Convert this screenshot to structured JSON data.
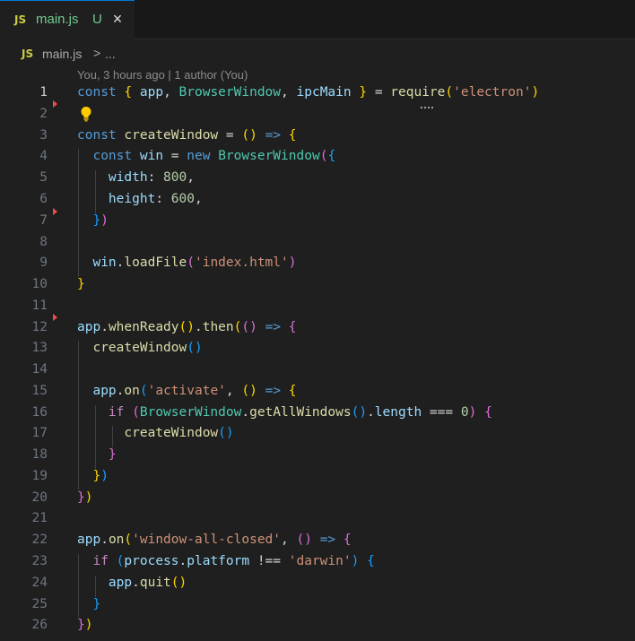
{
  "tab": {
    "badge": "JS",
    "filename": "main.js",
    "status": "U",
    "close_icon": "×"
  },
  "breadcrumb": {
    "badge": "JS",
    "file": "main.js",
    "separator": ">",
    "more": "..."
  },
  "blame": "You, 3 hours ago | 1 author (You)",
  "line_numbers": [
    "1",
    "2",
    "3",
    "4",
    "5",
    "6",
    "7",
    "8",
    "9",
    "10",
    "11",
    "12",
    "13",
    "14",
    "15",
    "16",
    "17",
    "18",
    "19",
    "20",
    "21",
    "22",
    "23",
    "24",
    "25",
    "26"
  ],
  "colors": {
    "accent": "#0078d4",
    "modified_marker": "#f14c4c",
    "lightbulb": "#ffcc00"
  },
  "code": {
    "l1": {
      "const": "const",
      "lb": "{",
      "app": "app",
      "c1": ",",
      "bw": "BrowserWindow",
      "c2": ",",
      "ipc": "ipcMain",
      "rb": "}",
      "eq": "=",
      "req": "require",
      "lp": "(",
      "str": "'electron'",
      "rp": ")"
    },
    "l3": {
      "const": "const",
      "name": "createWindow",
      "eq": "=",
      "parens": "()",
      "arrow": "=>",
      "lb": "{"
    },
    "l4": {
      "const": "const",
      "win": "win",
      "eq": "=",
      "new": "new",
      "cls": "BrowserWindow",
      "lp": "(",
      "lb": "{"
    },
    "l5": {
      "key": "width",
      "colon": ":",
      "num": "800",
      "comma": ","
    },
    "l6": {
      "key": "height",
      "colon": ":",
      "num": "600",
      "comma": ","
    },
    "l7": {
      "rb": "}",
      "rp": ")"
    },
    "l9": {
      "obj": "win",
      "dot": ".",
      "fn": "loadFile",
      "lp": "(",
      "str": "'index.html'",
      "rp": ")"
    },
    "l10": {
      "rb": "}"
    },
    "l12": {
      "obj": "app",
      "dot1": ".",
      "fn1": "whenReady",
      "p1": "()",
      "dot2": ".",
      "fn2": "then",
      "lp": "(",
      "p2": "()",
      "arrow": "=>",
      "lb": "{"
    },
    "l13": {
      "fn": "createWindow",
      "p": "()"
    },
    "l15": {
      "obj": "app",
      "dot": ".",
      "fn": "on",
      "lp": "(",
      "str": "'activate'",
      "comma": ",",
      "p": "()",
      "arrow": "=>",
      "lb": "{"
    },
    "l16": {
      "kw": "if",
      "lp": "(",
      "cls": "BrowserWindow",
      "dot1": ".",
      "fn": "getAllWindows",
      "p": "()",
      "dot2": ".",
      "prop": "length",
      "op": "===",
      "num": "0",
      "rp": ")",
      "lb": "{"
    },
    "l17": {
      "fn": "createWindow",
      "p": "()"
    },
    "l18": {
      "rb": "}"
    },
    "l19": {
      "rb": "}",
      "rp": ")"
    },
    "l20": {
      "rb": "}",
      "rp": ")"
    },
    "l22": {
      "obj": "app",
      "dot": ".",
      "fn": "on",
      "lp": "(",
      "str": "'window-all-closed'",
      "comma": ",",
      "p": "()",
      "arrow": "=>",
      "lb": "{"
    },
    "l23": {
      "kw": "if",
      "lp": "(",
      "obj": "process",
      "dot": ".",
      "prop": "platform",
      "op": "!==",
      "str": "'darwin'",
      "rp": ")",
      "lb": "{"
    },
    "l24": {
      "obj": "app",
      "dot": ".",
      "fn": "quit",
      "p": "()"
    },
    "l25": {
      "rb": "}"
    },
    "l26": {
      "rb": "}",
      "rp": ")"
    }
  }
}
